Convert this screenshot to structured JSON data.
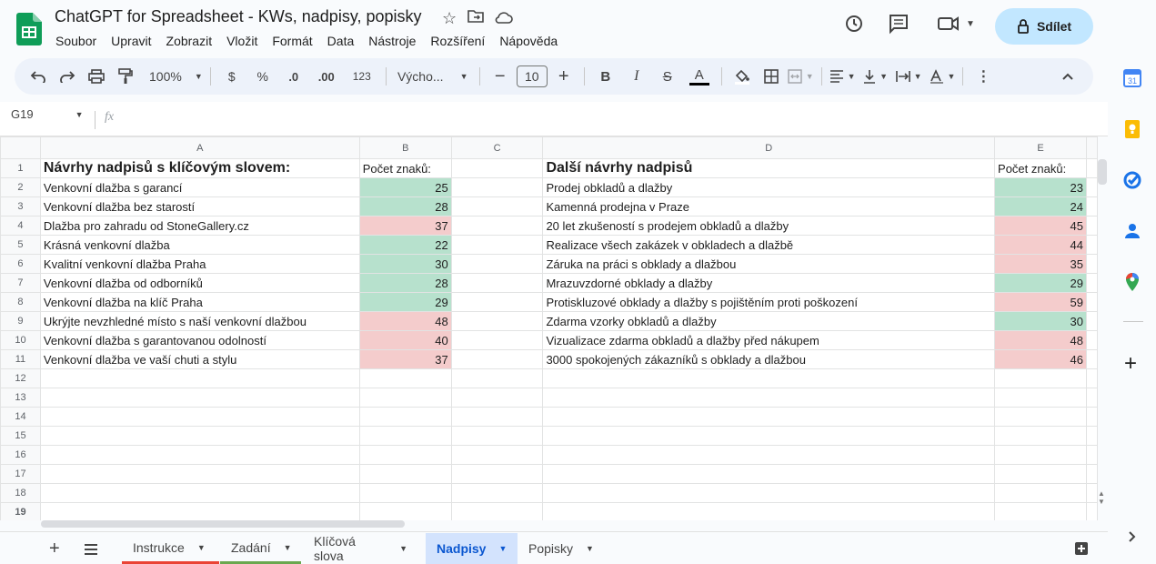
{
  "app": {
    "title": "ChatGPT for Spreadsheet - KWs, nadpisy, popisky",
    "menu": [
      "Soubor",
      "Upravit",
      "Zobrazit",
      "Vložit",
      "Formát",
      "Data",
      "Nástroje",
      "Rozšíření",
      "Nápověda"
    ],
    "share_label": "Sdílet"
  },
  "toolbar": {
    "zoom": "100%",
    "currency": "$",
    "percent": "%",
    "dec_decrease": ".0",
    "dec_increase": ".00",
    "number_format": "123",
    "font": "Výcho...",
    "font_size": "10",
    "bold": "B",
    "italic": "I",
    "strike": "S",
    "text_color": "A"
  },
  "formula_bar": {
    "cell_ref": "G19",
    "fx": "fx"
  },
  "columns": [
    "A",
    "B",
    "C",
    "D",
    "E"
  ],
  "rows": [
    {
      "n": "1",
      "a": "Návrhy nadpisů s klíčovým slovem:",
      "b": "Počet znaků:",
      "bc": "",
      "d": "Další návrhy nadpisů",
      "e": "Počet znaků:",
      "ec": ""
    },
    {
      "n": "2",
      "a": "Venkovní dlažba s garancí",
      "b": "25",
      "bc": "green",
      "d": "Prodej obkladů a dlažby",
      "e": "23",
      "ec": "green"
    },
    {
      "n": "3",
      "a": "Venkovní dlažba bez starostí",
      "b": "28",
      "bc": "green",
      "d": "Kamenná prodejna v Praze",
      "e": "24",
      "ec": "green"
    },
    {
      "n": "4",
      "a": "Dlažba pro zahradu od StoneGallery.cz",
      "b": "37",
      "bc": "red",
      "d": "20 let zkušeností s prodejem obkladů a dlažby",
      "e": "45",
      "ec": "red"
    },
    {
      "n": "5",
      "a": "Krásná venkovní dlažba",
      "b": "22",
      "bc": "green",
      "d": "Realizace všech zakázek v obkladech a dlažbě",
      "e": "44",
      "ec": "red"
    },
    {
      "n": "6",
      "a": "Kvalitní venkovní dlažba Praha",
      "b": "30",
      "bc": "green",
      "d": "Záruka na práci s obklady a dlažbou",
      "e": "35",
      "ec": "red"
    },
    {
      "n": "7",
      "a": "Venkovní dlažba od odborníků",
      "b": "28",
      "bc": "green",
      "d": "Mrazuvzdorné obklady a dlažby",
      "e": "29",
      "ec": "green"
    },
    {
      "n": "8",
      "a": "Venkovní dlažba na klíč Praha",
      "b": "29",
      "bc": "green",
      "d": "Protiskluzové obklady a dlažby s pojištěním proti poškození",
      "e": "59",
      "ec": "red"
    },
    {
      "n": "9",
      "a": "Ukrýjte nevzhledné místo s naší venkovní dlažbou",
      "b": "48",
      "bc": "red",
      "d": "Zdarma vzorky obkladů a dlažby",
      "e": "30",
      "ec": "green"
    },
    {
      "n": "10",
      "a": "Venkovní dlažba s garantovanou odolností",
      "b": "40",
      "bc": "red",
      "d": "Vizualizace zdarma obkladů a dlažby před nákupem",
      "e": "48",
      "ec": "red"
    },
    {
      "n": "11",
      "a": "Venkovní dlažba ve vaší chuti a stylu",
      "b": "37",
      "bc": "red",
      "d": "3000 spokojených zákazníků s obklady a dlažbou",
      "e": "46",
      "ec": "red"
    },
    {
      "n": "12",
      "a": "",
      "b": "",
      "bc": "",
      "d": "",
      "e": "",
      "ec": ""
    },
    {
      "n": "13",
      "a": "",
      "b": "",
      "bc": "",
      "d": "",
      "e": "",
      "ec": ""
    },
    {
      "n": "14",
      "a": "",
      "b": "",
      "bc": "",
      "d": "",
      "e": "",
      "ec": ""
    },
    {
      "n": "15",
      "a": "",
      "b": "",
      "bc": "",
      "d": "",
      "e": "",
      "ec": ""
    },
    {
      "n": "16",
      "a": "",
      "b": "",
      "bc": "",
      "d": "",
      "e": "",
      "ec": ""
    },
    {
      "n": "17",
      "a": "",
      "b": "",
      "bc": "",
      "d": "",
      "e": "",
      "ec": ""
    },
    {
      "n": "18",
      "a": "",
      "b": "",
      "bc": "",
      "d": "",
      "e": "",
      "ec": ""
    },
    {
      "n": "19",
      "a": "",
      "b": "",
      "bc": "",
      "d": "",
      "e": "",
      "ec": ""
    }
  ],
  "sheets": [
    {
      "label": "Instrukce",
      "underline": "#ea4335",
      "active": false
    },
    {
      "label": "Zadání",
      "underline": "#6aa84f",
      "active": false
    },
    {
      "label": "Klíčová slova",
      "underline": "",
      "active": false
    },
    {
      "label": "Nadpisy",
      "underline": "",
      "active": true
    },
    {
      "label": "Popisky",
      "underline": "",
      "active": false
    }
  ],
  "colors": {
    "accent": "#c2e7ff",
    "green": "#b7e1cd",
    "red": "#f4cccc",
    "active_tab": "#d3e3fd",
    "active_tab_text": "#0b57d0"
  }
}
